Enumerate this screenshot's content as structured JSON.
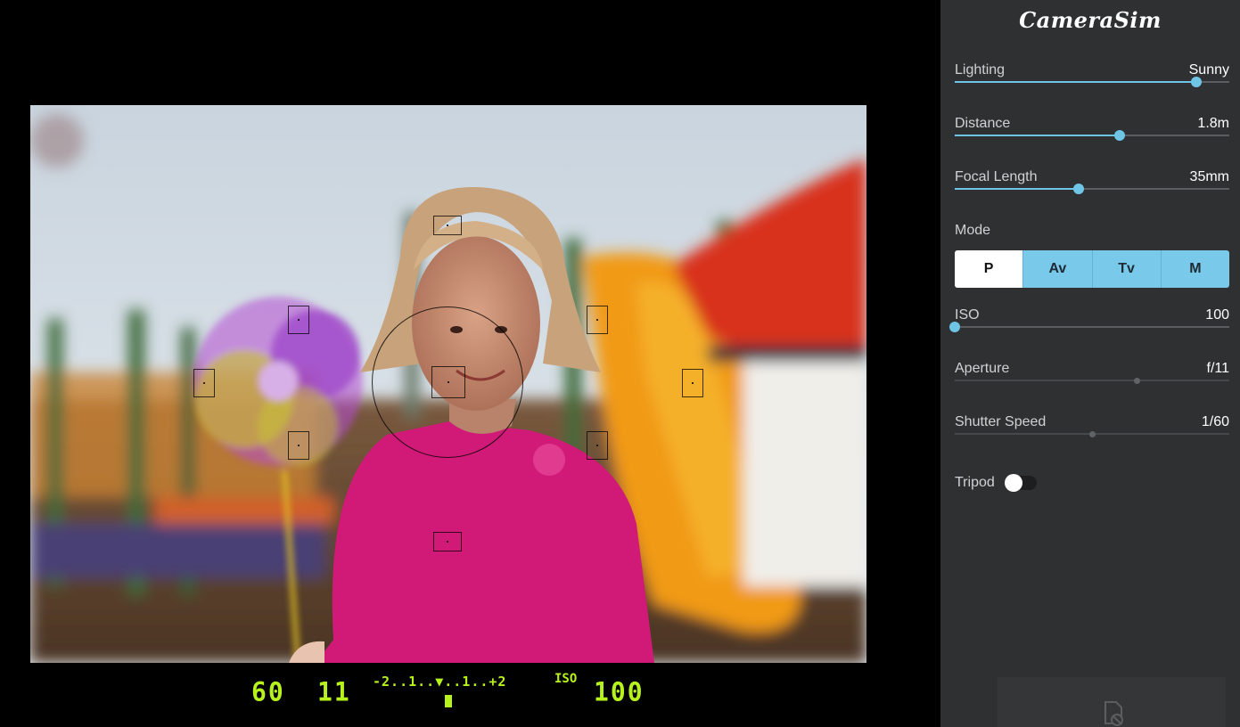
{
  "app": {
    "title": "CameraSim"
  },
  "controls": {
    "lighting": {
      "label": "Lighting",
      "value": "Sunny",
      "level": 0.88
    },
    "distance": {
      "label": "Distance",
      "value": "1.8m",
      "level": 0.6
    },
    "focal_length": {
      "label": "Focal Length",
      "value": "35mm",
      "level": 0.45
    },
    "mode": {
      "label": "Mode",
      "options": [
        "P",
        "Av",
        "Tv",
        "M"
      ],
      "selected": "P"
    },
    "iso": {
      "label": "ISO",
      "value": "100",
      "level": 0.0
    },
    "aperture": {
      "label": "Aperture",
      "value": "f/11",
      "level": 0.665
    },
    "shutter_speed": {
      "label": "Shutter Speed",
      "value": "1/60",
      "level": 0.5
    },
    "tripod": {
      "label": "Tripod",
      "on": false
    }
  },
  "viewfinder_readout": {
    "shutter": "60",
    "aperture": "11",
    "exposure_scale": "-2..1..▼..1..+2",
    "iso_label": "ISO",
    "iso_value": "100"
  },
  "icons": {
    "shutter_button": "camera-shutter-disabled-icon"
  },
  "colors": {
    "accent": "#6fc5e6",
    "lcd": "#b8f21c",
    "panel": "#2f3031"
  }
}
